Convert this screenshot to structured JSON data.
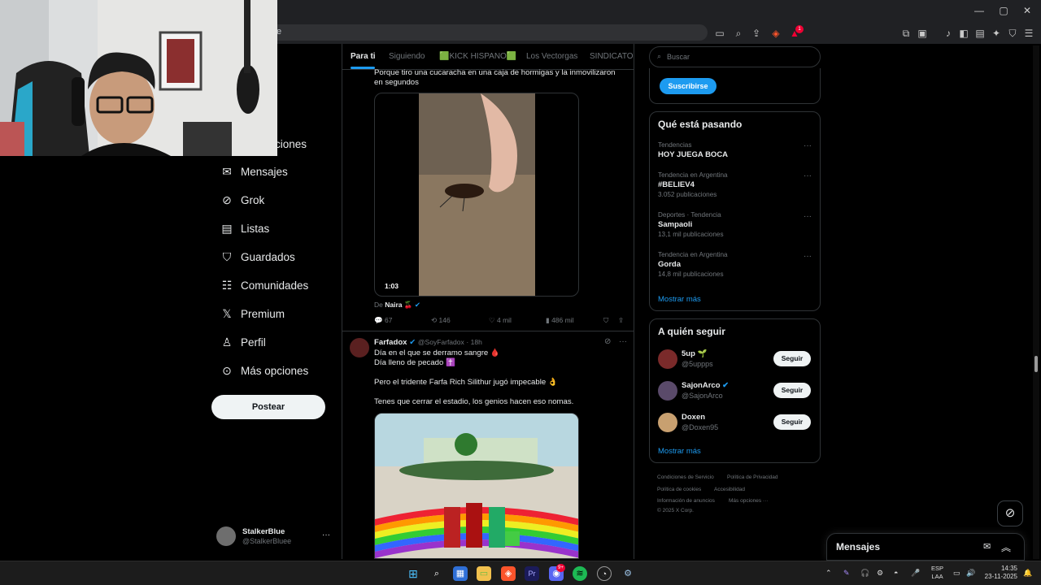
{
  "browser": {
    "address_partial": "e",
    "shield_badge": "1"
  },
  "nav": {
    "items": [
      {
        "label": "ciones",
        "icon": "more-options-icon"
      },
      {
        "label": "Mensajes",
        "icon": "mail-icon"
      },
      {
        "label": "Grok",
        "icon": "grok-icon"
      },
      {
        "label": "Listas",
        "icon": "list-icon"
      },
      {
        "label": "Guardados",
        "icon": "bookmark-icon"
      },
      {
        "label": "Comunidades",
        "icon": "communities-icon"
      },
      {
        "label": "Premium",
        "icon": "x-logo-icon"
      },
      {
        "label": "Perfil",
        "icon": "person-icon"
      },
      {
        "label": "Más opciones",
        "icon": "more-circle-icon"
      }
    ],
    "post_button": "Postear"
  },
  "account": {
    "name": "StalkerBlue",
    "handle": "@StalkerBluee",
    "more": "···"
  },
  "feed": {
    "tabs": [
      "Para ti",
      "Siguiendo",
      "🟩KICK HISPANO🟩",
      "Los Vectorgas",
      "SINDICATO D"
    ],
    "active_tab": 0,
    "tweet1": {
      "text": "Porque tiro una cucaracha en una caja de hormigas y la inmovilizaron en segundos",
      "video_duration": "1:03",
      "from_label": "De",
      "from_name": "Naira 🍒",
      "replies": "67",
      "retweets": "146",
      "likes": "4 mil",
      "views": "486 mil"
    },
    "tweet2": {
      "name": "Farfadox",
      "handle": "@SoyFarfadox",
      "time": "· 18h",
      "line1": "Día en el que se derramo sangre 🩸",
      "line2": "Día lleno de pecado ✝️",
      "line3": "Pero el tridente Farfa Rich Silithur jugó impecable 👌",
      "line4": "Tenes que cerrar el estadio, los genios hacen eso nomas."
    }
  },
  "right": {
    "search_placeholder": "Buscar",
    "subscribe_partial": "... ... ...",
    "subscribe_button": "Suscribirse",
    "trending_title": "Qué está pasando",
    "trends": [
      {
        "context": "Tendencias",
        "name": "HOY JUEGA BOCA",
        "count": ""
      },
      {
        "context": "Tendencia en Argentina",
        "name": "#BELIEV4",
        "count": "3.052 publicaciones"
      },
      {
        "context": "Deportes · Tendencia",
        "name": "Sampaoli",
        "count": "13,1 mil publicaciones"
      },
      {
        "context": "Tendencia en Argentina",
        "name": "Gorda",
        "count": "14,8 mil publicaciones"
      }
    ],
    "show_more": "Mostrar más",
    "who_title": "A quién seguir",
    "follow": [
      {
        "name": "5up 🌱",
        "handle": "@5uppps",
        "button": "Seguir",
        "verified": false
      },
      {
        "name": "SajonArco",
        "handle": "@SajonArco",
        "button": "Seguir",
        "verified": true
      },
      {
        "name": "Doxen",
        "handle": "@Doxen95",
        "button": "Seguir",
        "verified": false
      }
    ],
    "show_more2": "Mostrar más",
    "footer": {
      "tos": "Condiciones de Servicio",
      "privacy": "Política de Privacidad",
      "cookies": "Política de cookies",
      "accessibility": "Accesibilidad",
      "ads": "Información de anuncios",
      "more": "Más opciones ···",
      "copyright": "© 2025 X Corp."
    }
  },
  "messages_drawer": {
    "title": "Mensajes"
  },
  "taskbar": {
    "lang_top": "ESP",
    "lang_bottom": "LAA",
    "time": "14:35",
    "date": "23-11-2025",
    "discord_badge": "9+"
  },
  "colors": {
    "accent": "#1d9bf0",
    "background": "#000000",
    "border": "#2f3336",
    "muted": "#71767b"
  }
}
